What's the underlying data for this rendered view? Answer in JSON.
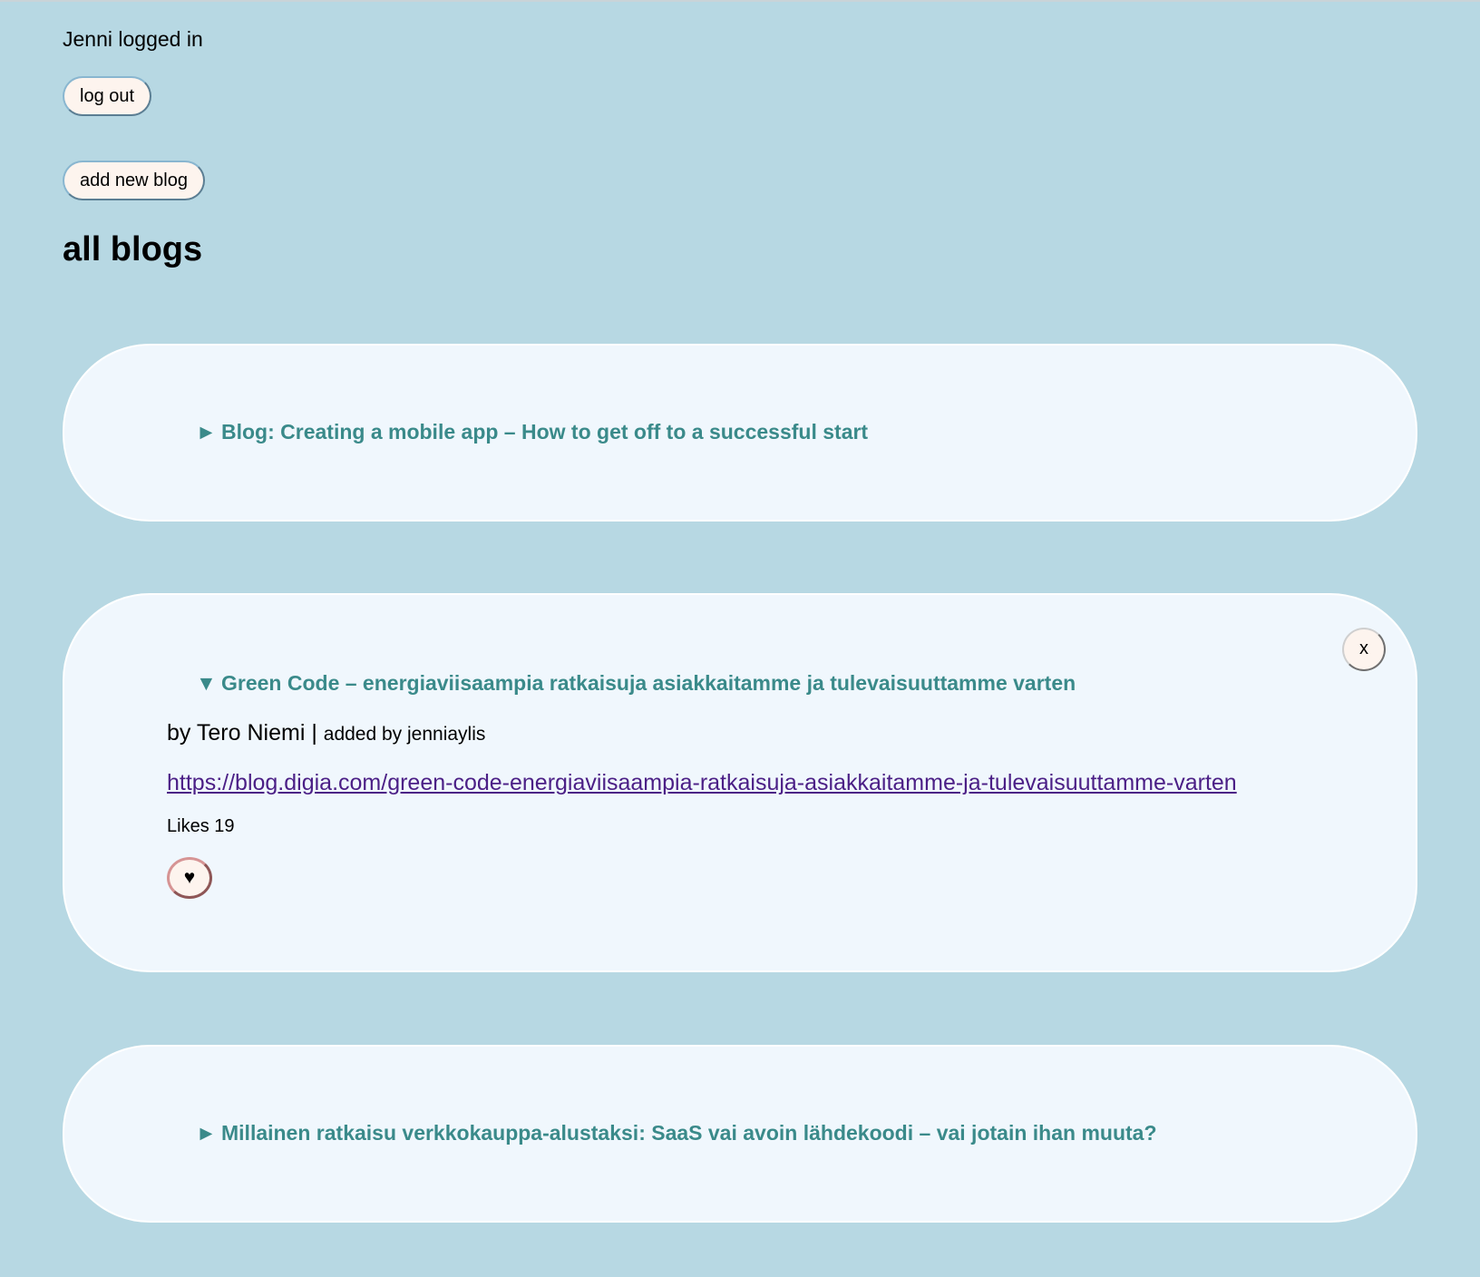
{
  "header": {
    "user_status": "Jenni logged in",
    "logout_label": "log out",
    "add_blog_label": "add new blog",
    "title": "all blogs"
  },
  "blogs": [
    {
      "toggle_icon": "►",
      "title": "Blog: Creating a mobile app – How to get off to a successful start",
      "expanded": false
    },
    {
      "toggle_icon": "▼",
      "title": "Green Code – energiaviisaampia ratkaisuja asiakkaitamme ja tulevaisuuttamme varten",
      "expanded": true,
      "remove_label": "x",
      "author_text": "by Tero Niemi",
      "separator": " | ",
      "added_by_text": "added by jenniaylis",
      "url": "https://blog.digia.com/green-code-energiaviisaampia-ratkaisuja-asiakkaitamme-ja-tulevaisuuttamme-varten",
      "likes_text": "Likes 19",
      "like_icon": "♥"
    },
    {
      "toggle_icon": "►",
      "title": "Millainen ratkaisu verkkokauppa-alustaksi: SaaS vai avoin lähdekoodi – vai jotain ihan muuta?",
      "expanded": false
    }
  ],
  "colors": {
    "background": "#b7d8e3",
    "card": "#f0f7fd",
    "title_accent": "#3a8a8a",
    "link": "#4b1f86",
    "button": "#fdf4ee"
  }
}
